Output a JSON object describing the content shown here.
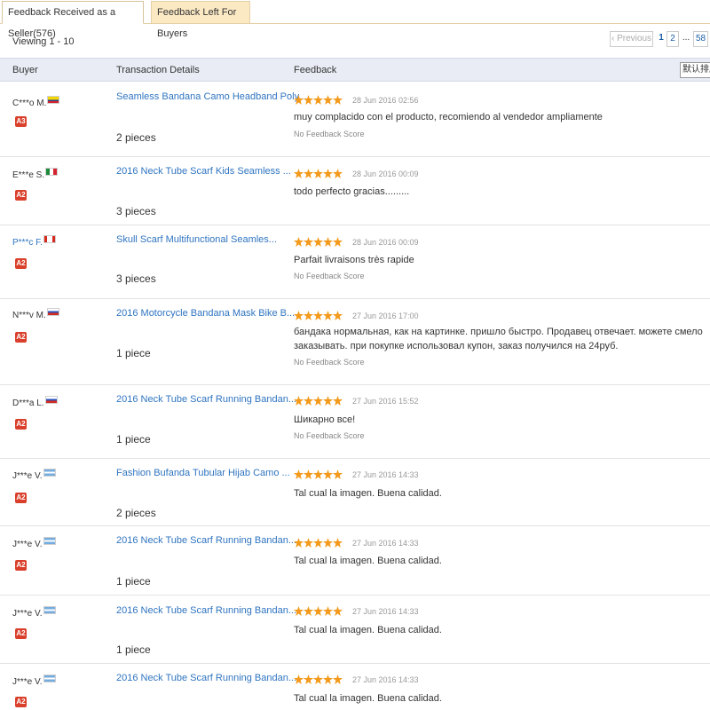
{
  "tabs": {
    "received": "Feedback Received as a Seller(576)",
    "left": "Feedback Left For Buyers"
  },
  "viewing": "Viewing 1 - 10",
  "pager": {
    "prev": "Previous",
    "page1": "1",
    "page2": "2",
    "dots": "...",
    "last": "58"
  },
  "table": {
    "col_buyer": "Buyer",
    "col_tx": "Transaction Details",
    "col_feedback": "Feedback",
    "sort": "默认排序"
  },
  "rows": [
    {
      "buyer": "C***o M.",
      "flag": "Colombia",
      "level": "A3",
      "product": "Seamless Bandana Camo Headband Poly...",
      "qty": "2 pieces",
      "stars": 5,
      "date": "28 Jun 2016 02:56",
      "comment": "muy complacido con el producto, recomiendo al vendedor ampliamente",
      "score": "No Feedback Score"
    },
    {
      "buyer": "E***e S.",
      "flag": "Mexico",
      "level": "A2",
      "product": "2016 Neck Tube Scarf Kids Seamless ...",
      "qty": "3 pieces",
      "stars": 5,
      "date": "28 Jun 2016 00:09",
      "comment": "todo perfecto gracias.........",
      "score": ""
    },
    {
      "buyer": "P***c F.",
      "flag": "Canada",
      "level": "A2",
      "product": "Skull Scarf Multifunctional Seamles...",
      "qty": "3 pieces",
      "stars": 5,
      "date": "28 Jun 2016 00:09",
      "comment": "Parfait livraisons très rapide",
      "score": "No Feedback Score"
    },
    {
      "buyer": "N***v M.",
      "flag": "Russia",
      "level": "A2",
      "product": "2016 Motorcycle Bandana Mask Bike B...",
      "qty": "1 piece",
      "stars": 5,
      "date": "27 Jun 2016 17:00",
      "comment": "бандака нормальная, как на картинке. пришло быстро. Продавец отвечает. можете смело заказывать. при покупке использовал купон, заказ получился на 24руб.",
      "score": "No Feedback Score"
    },
    {
      "buyer": "D***a L.",
      "flag": "Russia",
      "level": "A2",
      "product": "2016 Neck Tube Scarf Running Bandan...",
      "qty": "1 piece",
      "stars": 5,
      "date": "27 Jun 2016 15:52",
      "comment": "Шикарно все!",
      "score": "No Feedback Score"
    },
    {
      "buyer": "J***e V.",
      "flag": "Argentina",
      "level": "A2",
      "product": "Fashion Bufanda Tubular Hijab Camo ...",
      "qty": "2 pieces",
      "stars": 5,
      "date": "27 Jun 2016 14:33",
      "comment": "Tal cual la imagen. Buena calidad.",
      "score": ""
    },
    {
      "buyer": "J***e V.",
      "flag": "Argentina",
      "level": "A2",
      "product": "2016 Neck Tube Scarf Running Bandan...",
      "qty": "1 piece",
      "stars": 5,
      "date": "27 Jun 2016 14:33",
      "comment": "Tal cual la imagen. Buena calidad.",
      "score": ""
    },
    {
      "buyer": "J***e V.",
      "flag": "Argentina",
      "level": "A2",
      "product": "2016 Neck Tube Scarf Running Bandan...",
      "qty": "1 piece",
      "stars": 5,
      "date": "27 Jun 2016 14:33",
      "comment": "Tal cual la imagen. Buena calidad.",
      "score": ""
    },
    {
      "buyer": "J***e V.",
      "flag": "Argentina",
      "level": "A2",
      "product": "2016 Neck Tube Scarf Running Bandan...",
      "qty": "",
      "stars": 5,
      "date": "27 Jun 2016 14:33",
      "comment": "Tal cual la imagen. Buena calidad.",
      "score": ""
    }
  ],
  "colors": {
    "link": "#2f74c0",
    "star": "#f39a1c",
    "badge": "#d93f2a",
    "tab_inactive": "#fbe9c4",
    "header_bg": "#e9ecf4"
  }
}
